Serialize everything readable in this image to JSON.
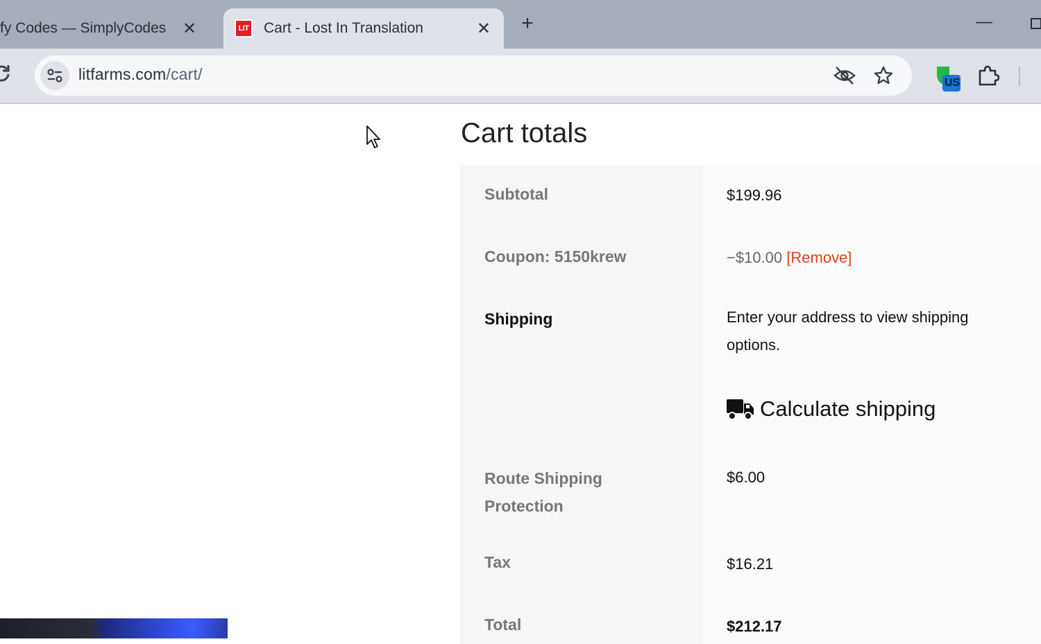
{
  "browser": {
    "tabs": [
      {
        "title": "fy Codes — SimplyCodes",
        "active": false
      },
      {
        "title": "Cart - Lost In Translation",
        "active": true,
        "favicon_text": "LIT"
      }
    ],
    "url_domain": "litfarms.com",
    "url_path": "/cart/",
    "extension_badge": "US"
  },
  "cart_totals": {
    "title": "Cart totals",
    "rows": {
      "subtotal": {
        "label": "Subtotal",
        "value": "$199.96"
      },
      "coupon": {
        "label": "Coupon: 5150krew",
        "value": "−$10.00",
        "remove_link": "[Remove]"
      },
      "shipping": {
        "label": "Shipping",
        "message": "Enter your address to view shipping options.",
        "calculate_label": "Calculate shipping"
      },
      "route": {
        "label": "Route Shipping Protection",
        "value": "$6.00"
      },
      "tax": {
        "label": "Tax",
        "value": "$16.21"
      },
      "total": {
        "label": "Total",
        "value": "$212.17"
      }
    }
  },
  "icons": {
    "close": "close-icon",
    "new_tab": "plus-icon",
    "reload": "reload-icon",
    "site_info": "tune-icon",
    "eye_off": "eye-off-icon",
    "bookmark": "star-icon",
    "extension": "puzzle-icon",
    "shipping": "truck-icon"
  },
  "colors": {
    "remove_link": "#e2401c",
    "favicon": "#e41e26",
    "tabstrip": "#a5acba"
  }
}
